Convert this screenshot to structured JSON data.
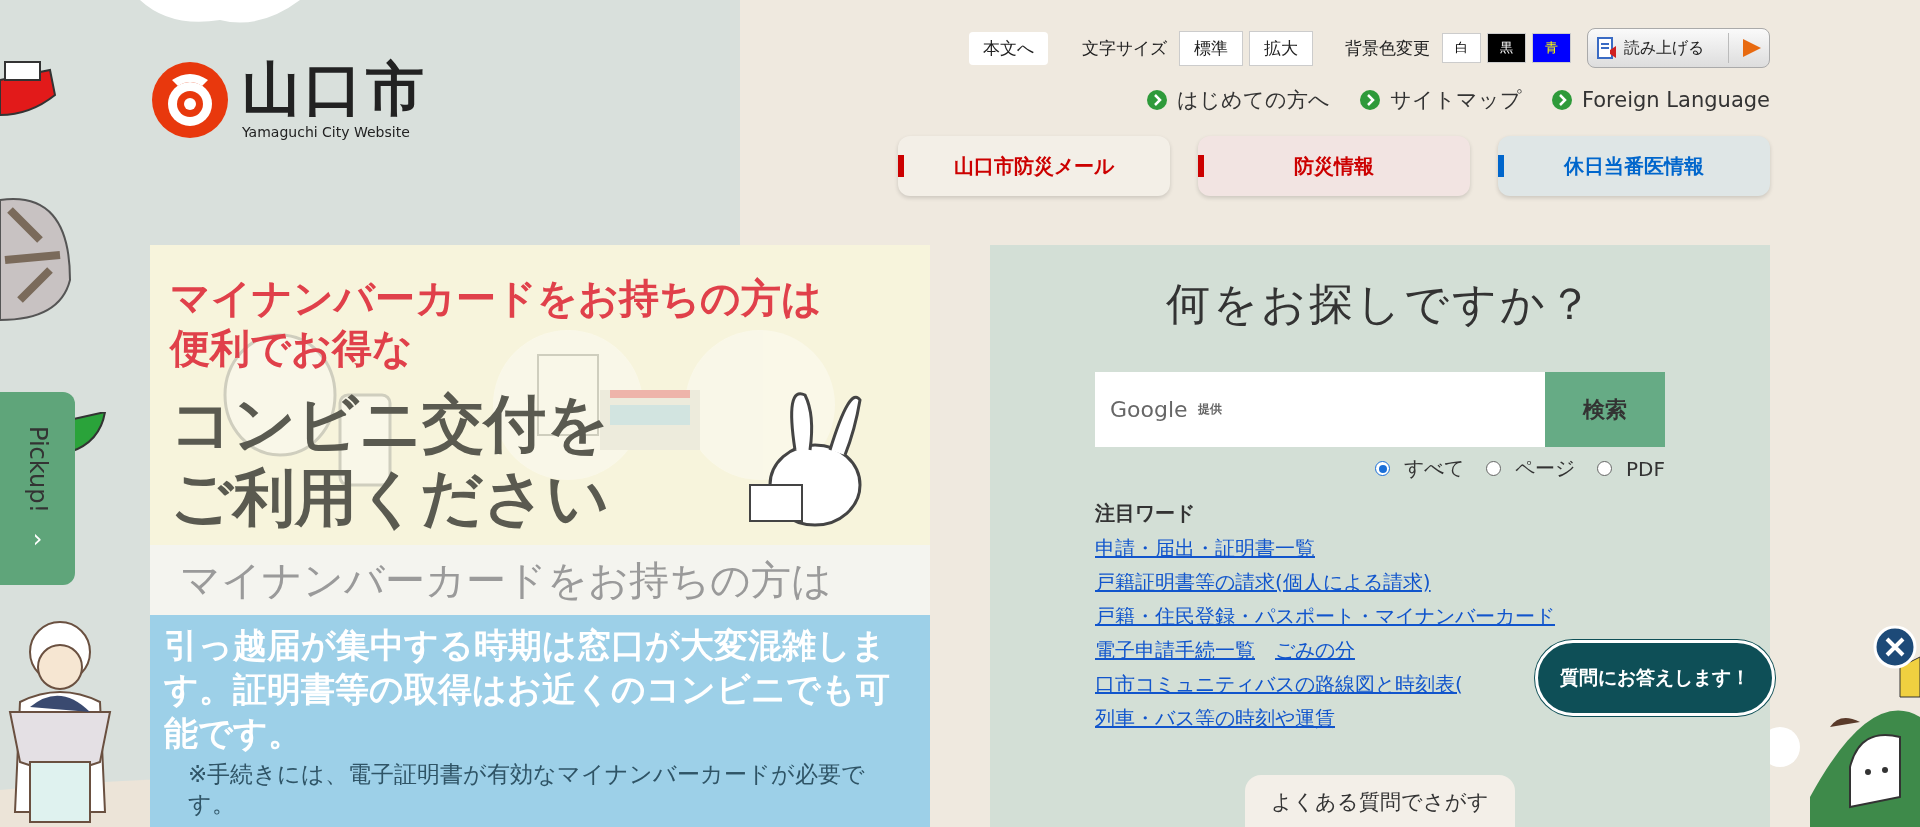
{
  "header": {
    "logo_text": "山口市",
    "logo_subtitle": "Yamaguchi City Website"
  },
  "utility_bar": {
    "skip_link": "本文へ",
    "font_size_label": "文字サイズ",
    "font_sizes": [
      "標準",
      "拡大"
    ],
    "bg_color_label": "背景色変更",
    "bg_colors": [
      {
        "label": "白",
        "color": "#ffffff"
      },
      {
        "label": "黒",
        "color": "#000000"
      },
      {
        "label": "青",
        "color": "#0000ff"
      }
    ],
    "read_aloud": "読み上げる"
  },
  "nav_links": [
    "はじめての方へ",
    "サイトマップ",
    "Foreign Language"
  ],
  "quick_buttons": [
    {
      "label": "山口市防災メール",
      "kind": "mail",
      "color": "#cc0000"
    },
    {
      "label": "防災情報",
      "kind": "alert",
      "color": "#cc0000"
    },
    {
      "label": "休日当番医情報",
      "kind": "medical",
      "color": "#0066cc"
    }
  ],
  "pickup_tab": {
    "label": "Pickup!",
    "arrow": "›"
  },
  "slide": {
    "headline_lines": [
      "マイナンバーカードをお持ちの方は",
      "便利でお得な"
    ],
    "title_lines": [
      "コンビニ交付を",
      "ご利用ください"
    ],
    "subtitle": "マイナンバーカードをお持ちの方は",
    "notice": "引っ越届が集中する時期は窓口が大変混雑します。証明書等の取得はお近くのコンビニでも可能です。",
    "note": "※手続きには、電子証明書が有効なマイナンバーカードが必要です。"
  },
  "search": {
    "title": "何をお探しですか？",
    "provider": "Google",
    "provider_note": "提供",
    "button": "検索",
    "scopes": [
      {
        "label": "すべて",
        "selected": true
      },
      {
        "label": "ページ",
        "selected": false
      },
      {
        "label": "PDF",
        "selected": false
      }
    ],
    "keywords_title": "注目ワード",
    "keywords": [
      "申請・届出・証明書一覧",
      "戸籍証明書等の請求(個人による請求)",
      "戸籍・住民登録・パスポート・マイナンバーカード",
      "電子申請手続一覧",
      "ごみの分",
      "口市コミュニティバスの路線図と時刻表(",
      "列車・バス等の時刻や運賃"
    ],
    "faq_button": "よくある質問でさがす"
  },
  "chat": {
    "label": "質問にお答えします！"
  }
}
